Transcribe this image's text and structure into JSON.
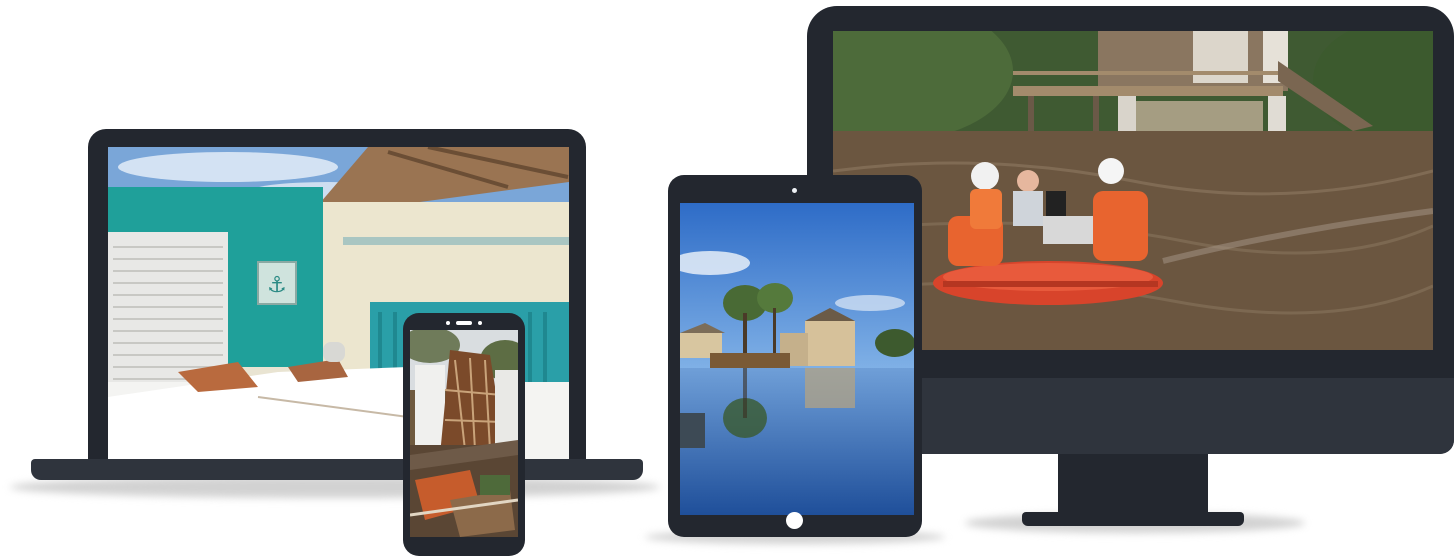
{
  "devices": {
    "desktop": {
      "photo": "flood-boat-rescue"
    },
    "tablet": {
      "photo": "flooded-neighborhood-reflection"
    },
    "laptop": {
      "photo": "storm-damaged-bedroom"
    },
    "phone": {
      "photo": "collapsed-house-debris"
    }
  },
  "colors": {
    "device_frame": "#23272f",
    "device_chin": "#2f343d",
    "shadow": "#d2d2d2",
    "background": "#ffffff"
  }
}
